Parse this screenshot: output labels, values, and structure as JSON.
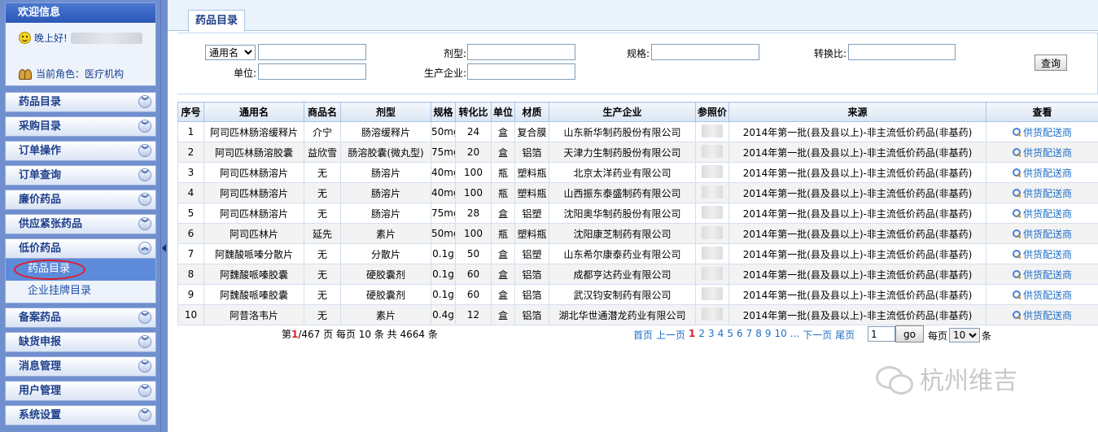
{
  "sidebar": {
    "welcome_title": "欢迎信息",
    "greeting": "晚上好!",
    "role": "当前角色：医疗机构",
    "menu_top": [
      "药品目录",
      "采购目录",
      "订单操作",
      "订单查询",
      "廉价药品",
      "供应紧张药品",
      "低价药品"
    ],
    "expanded": {
      "sub_items": [
        "药品目录",
        "企业挂牌目录"
      ],
      "active_index": 0
    },
    "menu_bottom": [
      "备案药品",
      "缺货申报",
      "消息管理",
      "用户管理",
      "系统设置"
    ],
    "icons": {
      "collapse": "chevron-down-icon",
      "expand": "chevron-up-icon"
    }
  },
  "tab": {
    "label": "药品目录"
  },
  "search": {
    "name_type_selected": "通用名",
    "dosage_label": "剂型:",
    "spec_label": "规格:",
    "ratio_label": "转换比:",
    "unit_label": "单位:",
    "manufacturer_label": "生产企业:",
    "query_label": "查询"
  },
  "table": {
    "columns": [
      "序号",
      "通用名",
      "商品名",
      "剂型",
      "规格",
      "转化比",
      "单位",
      "材质",
      "生产企业",
      "参照价",
      "来源",
      "查看"
    ],
    "link_label": "供货配送商",
    "rows": [
      [
        "1",
        "阿司匹林肠溶缓释片",
        "介宁",
        "肠溶缓释片",
        "50mg",
        "24",
        "盒",
        "复合膜",
        "山东新华制药股份有限公司",
        "",
        "2014年第一批(县及县以上)-非主流低价药品(非基药)"
      ],
      [
        "2",
        "阿司匹林肠溶胶囊",
        "益欣雪",
        "肠溶胶囊(微丸型)",
        "75mg",
        "20",
        "盒",
        "铝箔",
        "天津力生制药股份有限公司",
        "",
        "2014年第一批(县及县以上)-非主流低价药品(非基药)"
      ],
      [
        "3",
        "阿司匹林肠溶片",
        "无",
        "肠溶片",
        "40mg",
        "100",
        "瓶",
        "塑料瓶",
        "北京太洋药业有限公司",
        "",
        "2014年第一批(县及县以上)-非主流低价药品(非基药)"
      ],
      [
        "4",
        "阿司匹林肠溶片",
        "无",
        "肠溶片",
        "40mg",
        "100",
        "瓶",
        "塑料瓶",
        "山西振东泰盛制药有限公司",
        "",
        "2014年第一批(县及县以上)-非主流低价药品(非基药)"
      ],
      [
        "5",
        "阿司匹林肠溶片",
        "无",
        "肠溶片",
        "75mg",
        "28",
        "盒",
        "铝塑",
        "沈阳奥华制药股份有限公司",
        "",
        "2014年第一批(县及县以上)-非主流低价药品(非基药)"
      ],
      [
        "6",
        "阿司匹林片",
        "延先",
        "素片",
        "50mg",
        "100",
        "瓶",
        "塑料瓶",
        "沈阳康芝制药有限公司",
        "",
        "2014年第一批(县及县以上)-非主流低价药品(非基药)"
      ],
      [
        "7",
        "阿魏酸哌嗪分散片",
        "无",
        "分散片",
        "0.1g",
        "50",
        "盒",
        "铝塑",
        "山东希尔康泰药业有限公司",
        "",
        "2014年第一批(县及县以上)-非主流低价药品(非基药)"
      ],
      [
        "8",
        "阿魏酸哌嗪胶囊",
        "无",
        "硬胶囊剂",
        "0.1g",
        "60",
        "盒",
        "铝箔",
        "成都亨达药业有限公司",
        "",
        "2014年第一批(县及县以上)-非主流低价药品(非基药)"
      ],
      [
        "9",
        "阿魏酸哌嗪胶囊",
        "无",
        "硬胶囊剂",
        "0.1g",
        "60",
        "盒",
        "铝箔",
        "武汉钧安制药有限公司",
        "",
        "2014年第一批(县及县以上)-非主流低价药品(非基药)"
      ],
      [
        "10",
        "阿昔洛韦片",
        "无",
        "素片",
        "0.4g",
        "12",
        "盒",
        "铝箔",
        "湖北华世通潜龙药业有限公司",
        "",
        "2014年第一批(县及县以上)-非主流低价药品(非基药)"
      ]
    ]
  },
  "pager": {
    "prefix": "第",
    "current": "1",
    "suffix": "/467 页 每页 10 条 共 4664 条",
    "first": "首页",
    "prev": "上一页",
    "pages": [
      "1",
      "2",
      "3",
      "4",
      "5",
      "6",
      "7",
      "8",
      "9",
      "10"
    ],
    "ellipsis": "...",
    "next": "下一页",
    "last": "尾页",
    "page_input_value": "1",
    "go_label": "go",
    "per_page_prefix": "每页",
    "per_page_value": "10",
    "per_page_suffix": "条"
  },
  "watermark": {
    "text": "杭州维吉"
  },
  "colors": {
    "sidebar_bg": "#6f8fcf",
    "accent_red": "#e01c2a",
    "link_blue": "#1e6fc8"
  }
}
